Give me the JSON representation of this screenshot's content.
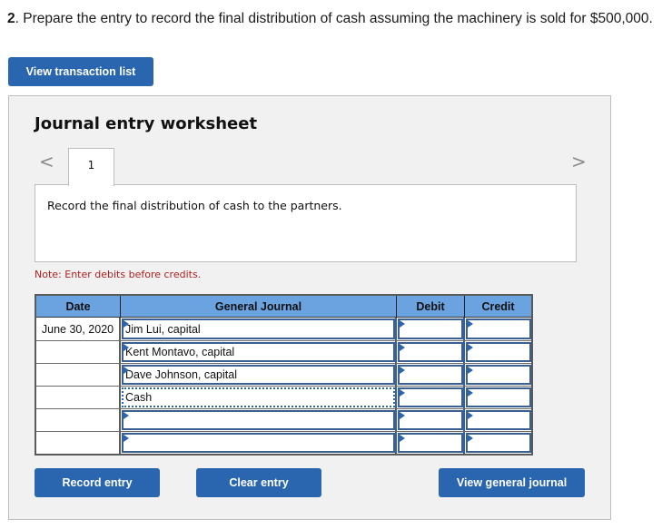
{
  "question": {
    "number": "2",
    "text": ". Prepare the entry to record the final distribution of cash assuming the machinery is sold for $500,000."
  },
  "buttons": {
    "view_transaction_list": "View transaction list",
    "record_entry": "Record entry",
    "clear_entry": "Clear entry",
    "view_general_journal": "View general journal"
  },
  "worksheet": {
    "title": "Journal entry worksheet",
    "nav_prev": "<",
    "nav_next": ">",
    "active_tab": "1",
    "instruction": "Record the final distribution of cash to the partners.",
    "note": "Note: Enter debits before credits."
  },
  "journal": {
    "headers": {
      "date": "Date",
      "account": "General Journal",
      "debit": "Debit",
      "credit": "Credit"
    },
    "rows": [
      {
        "date": "June 30, 2020",
        "account": "Jim Lui, capital",
        "debit": "",
        "credit": ""
      },
      {
        "date": "",
        "account": "Kent Montavo, capital",
        "debit": "",
        "credit": ""
      },
      {
        "date": "",
        "account": "Dave Johnson, capital",
        "debit": "",
        "credit": ""
      },
      {
        "date": "",
        "account": "Cash",
        "debit": "",
        "credit": ""
      },
      {
        "date": "",
        "account": "",
        "debit": "",
        "credit": ""
      },
      {
        "date": "",
        "account": "",
        "debit": "",
        "credit": ""
      }
    ]
  },
  "colors": {
    "primary_button": "#2a66b0",
    "table_header": "#6ba2e0",
    "note_text": "#b01e1e",
    "panel_background": "#f1f1f1"
  }
}
